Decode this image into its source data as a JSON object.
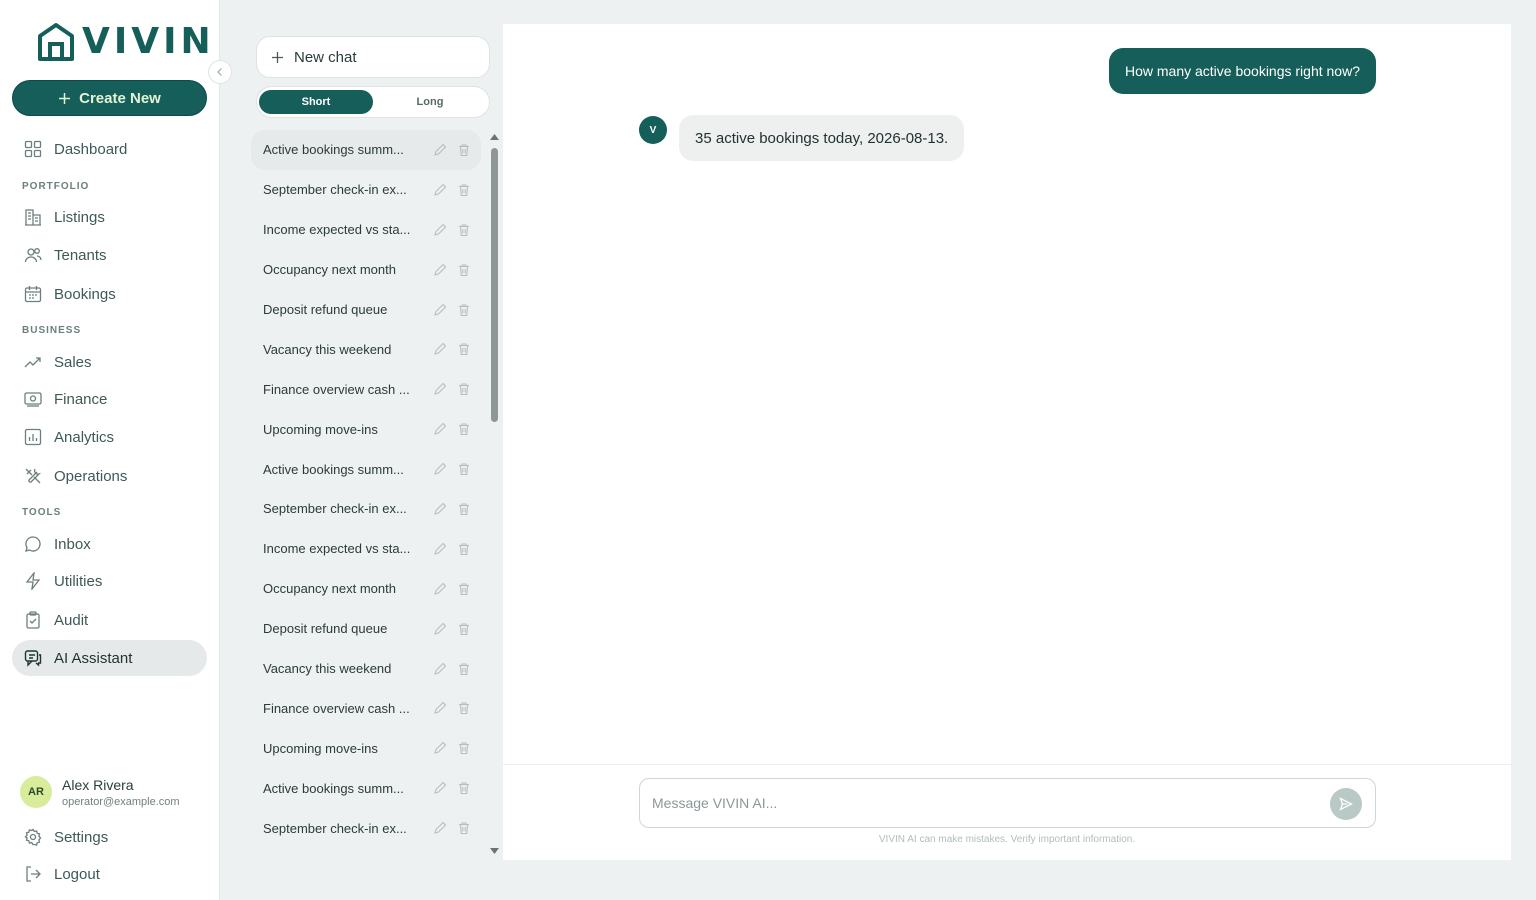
{
  "app": {
    "logo_text": "VIVIN"
  },
  "sidebar": {
    "create_label": "Create New",
    "nav": [
      {
        "label": "Dashboard",
        "icon": "grid-icon"
      },
      {
        "label": "Listings",
        "icon": "building-icon"
      },
      {
        "label": "Tenants",
        "icon": "users-icon"
      },
      {
        "label": "Bookings",
        "icon": "calendar-icon"
      },
      {
        "label": "Sales",
        "icon": "trending-up-icon"
      },
      {
        "label": "Finance",
        "icon": "banknote-icon"
      },
      {
        "label": "Analytics",
        "icon": "bar-chart-icon"
      },
      {
        "label": "Operations",
        "icon": "tools-icon"
      },
      {
        "label": "Inbox",
        "icon": "chat-bubble-icon"
      },
      {
        "label": "Utilities",
        "icon": "lightning-icon"
      },
      {
        "label": "Audit",
        "icon": "clipboard-icon"
      },
      {
        "label": "AI Assistant",
        "icon": "ai-chat-icon",
        "active": true
      }
    ],
    "sections": {
      "portfolio": "PORTFOLIO",
      "business": "BUSINESS",
      "tools": "TOOLS"
    },
    "user": {
      "initials": "AR",
      "name": "Alex Rivera",
      "email": "operator@example.com"
    },
    "settings_label": "Settings",
    "logout_label": "Logout"
  },
  "history": {
    "new_chat_label": "New chat",
    "toggle": {
      "short": "Short",
      "long": "Long",
      "selected": "Short"
    },
    "conversations": [
      "Active bookings summ...",
      "September check-in ex...",
      "Income expected vs sta...",
      "Occupancy next month",
      "Deposit refund queue",
      "Vacancy this weekend",
      "Finance overview cash ...",
      "Upcoming move-ins",
      "Active bookings summ...",
      "September check-in ex...",
      "Income expected vs sta...",
      "Occupancy next month",
      "Deposit refund queue",
      "Vacancy this weekend",
      "Finance overview cash ...",
      "Upcoming move-ins",
      "Active bookings summ...",
      "September check-in ex..."
    ]
  },
  "chat": {
    "user_message": "How many active bookings right now?",
    "ai_avatar": "V",
    "ai_message": "35 active bookings today, 2026-08-13.",
    "input_placeholder": "Message VIVIN AI...",
    "input_value": "",
    "disclaimer": "VIVIN AI can make mistakes. Verify important information."
  },
  "colors": {
    "brand": "#155e5a",
    "accent_text": "#e5f3d5",
    "avatar_bg": "#d9ec9c"
  }
}
